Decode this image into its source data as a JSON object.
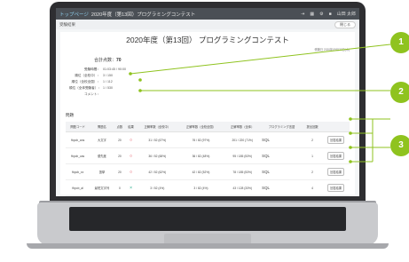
{
  "screen": {
    "breadcrumb": "トップページ",
    "title": "2020年度（第13回）プログラミングコンテスト",
    "topbar_icons": [
      "logout-icon",
      "grid-icon",
      "gear-icon",
      "user-icon"
    ],
    "user_label": "山田 太郎",
    "subbar_label": "受験結果",
    "close_label": "閉じる",
    "heading": "2020年度（第13回） プログラミングコンテスト",
    "date": "受験日 2020年09月23日(水)",
    "score_label": "合計点数：",
    "score_value": "70",
    "meta": [
      {
        "key": "受験時間：",
        "value": "01:03:45 / 90:00"
      },
      {
        "key": "順位（全校中）：",
        "value": "3 / 150"
      },
      {
        "key": "順位（全校全国）：",
        "value": "1 / 112"
      },
      {
        "key": "順位（全体受験者）：",
        "value": "1 / 530"
      },
      {
        "key": "コメント：",
        "value": ""
      }
    ],
    "section_label": "問題",
    "table": {
      "headers": [
        "問題コード",
        "問題名",
        "点数",
        "結果",
        "正解率数（全校中）",
        "正解率数（全校全国）",
        "正解率数（全体）",
        "プログラミング言語",
        "提出回数",
        ""
      ],
      "rows": [
        {
          "code": "fbpcb_ans",
          "name": "大文字",
          "score": "20",
          "result": "○",
          "r1": "31 / 52 (67%)",
          "r2": "76 / 82 (97%)",
          "r3": "201 / 220 (71%)",
          "lang": "SQL",
          "count": "2",
          "btn": "回答結果"
        },
        {
          "code": "fbpcb_cas",
          "name": "優先度",
          "score": "20",
          "result": "○",
          "r1": "36 / 52 (68%)",
          "r2": "36 / 82 (48%)",
          "r3": "95 / 185 (53%)",
          "lang": "SQL",
          "count": "1",
          "btn": "回答結果"
        },
        {
          "code": "fbpcb_xx",
          "name": "選挙",
          "score": "20",
          "result": "○",
          "r1": "42 / 52 (62%)",
          "r2": "42 / 82 (52%)",
          "r3": "78 / 185 (53%)",
          "lang": "SQL",
          "count": "2",
          "btn": "回答結果"
        },
        {
          "code": "fbpcb_al",
          "name": "最短文字列",
          "score": "0",
          "result": "×",
          "r1": "3 / 52 (4%)",
          "r2": "3 / 82 (4%)",
          "r3": "43 / 128 (33%)",
          "lang": "SQL",
          "count": "4",
          "btn": "回答結果"
        }
      ]
    }
  },
  "bubbles": [
    "1",
    "2",
    "3"
  ],
  "colors": {
    "accent": "#8fc31f",
    "topbar": "#4a4f55",
    "ok": "#dd2233",
    "ng": "#22aa88"
  }
}
